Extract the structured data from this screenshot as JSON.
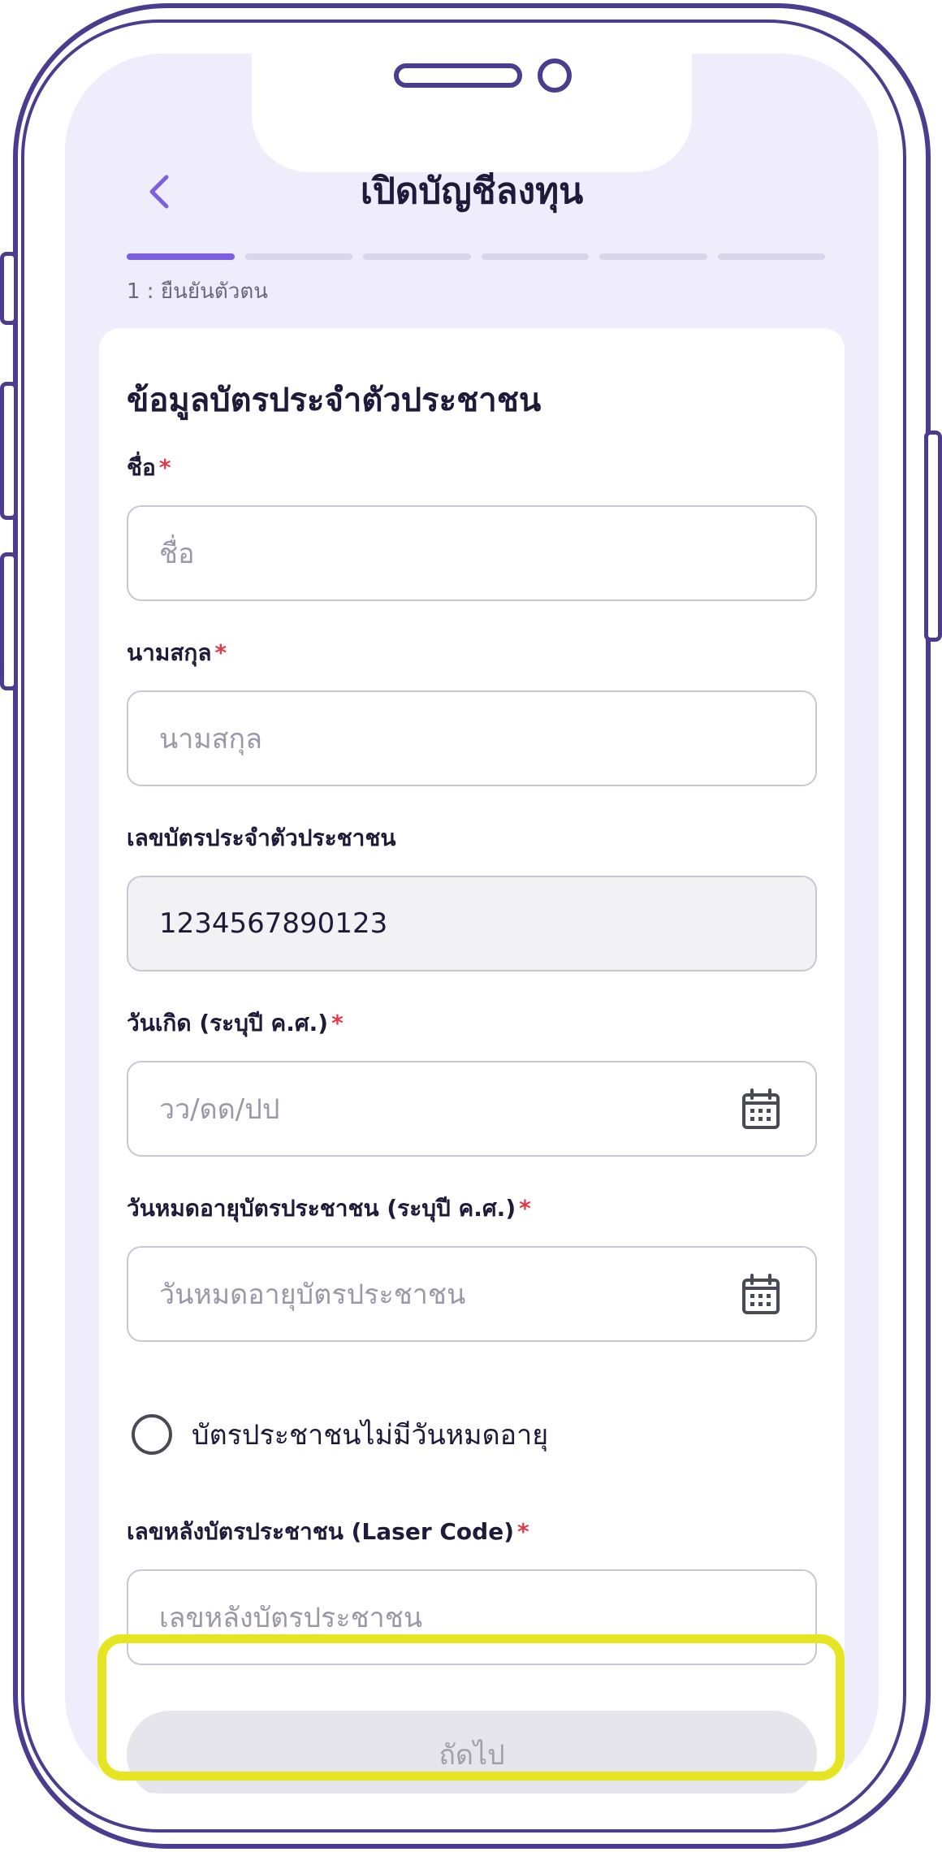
{
  "header": {
    "title": "เปิดบัญชีลงทุน",
    "back_icon": "chevron-left-icon",
    "steps_total": 6,
    "step_active": 1,
    "step_label": "1 : ยืนยันตัวตน"
  },
  "form": {
    "section_title": "ข้อมูลบัตรประจำตัวประชาชน",
    "required_mark": "*",
    "first_name": {
      "label": "ชื่อ",
      "placeholder": "ชื่อ"
    },
    "last_name": {
      "label": "นามสกุล",
      "placeholder": "นามสกุล"
    },
    "id_number": {
      "label": "เลขบัตรประจำตัวประชาชน",
      "value": "1234567890123"
    },
    "birth_date": {
      "label": "วันเกิด (ระบุปี ค.ศ.)",
      "placeholder": "วว/ดด/ปป",
      "icon": "calendar-icon"
    },
    "expiry_date": {
      "label": "วันหมดอายุบัตรประชาชน (ระบุปี ค.ศ.)",
      "placeholder": "วันหมดอายุบัตรประชาชน",
      "icon": "calendar-icon"
    },
    "no_expiry": {
      "label": "บัตรประชาชนไม่มีวันหมดอายุ",
      "checked": false
    },
    "laser_code": {
      "label": "เลขหลังบัตรประชาชน (Laser Code)",
      "placeholder": "เลขหลังบัตรประชาชน"
    }
  },
  "actions": {
    "next_label": "ถัดไป",
    "next_enabled": false
  },
  "colors": {
    "accent": "#7b5fe0",
    "frame": "#4b3c8f",
    "required": "#e03a4b",
    "highlight": "#e5e523"
  }
}
